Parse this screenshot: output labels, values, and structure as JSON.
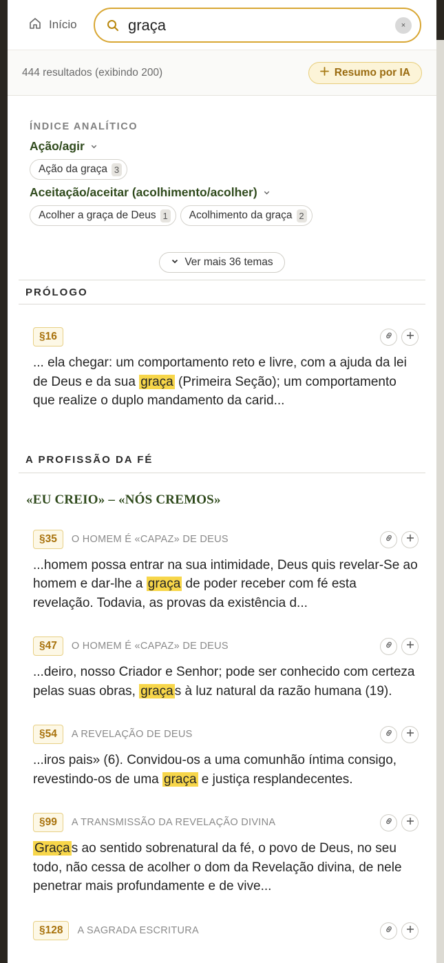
{
  "header": {
    "home_label": "Início",
    "search_value": "graça",
    "clear_symbol": "×"
  },
  "results": {
    "count_text": "444 resultados (exibindo 200)",
    "summary_label": "Resumo por IA",
    "summary_icon": "sparkle-plus"
  },
  "index": {
    "heading": "ÍNDICE ANALÍTICO",
    "topics": [
      {
        "label": "Ação/agir",
        "chips": [
          {
            "label": "Ação da graça",
            "count": "3"
          }
        ]
      },
      {
        "label": "Aceitação/aceitar (acolhimento/acolher)",
        "chips": [
          {
            "label": "Acolher a graça de Deus",
            "count": "1"
          },
          {
            "label": "Acolhimento da graça",
            "count": "2"
          }
        ]
      }
    ],
    "more_label": "Ver mais 36 temas"
  },
  "sections": [
    {
      "title": "PRÓLOGO"
    },
    {
      "title": "A PROFISSÃO DA FÉ",
      "subsection": "«EU CREIO» – «NÓS CREMOS»"
    }
  ],
  "entries": [
    {
      "para": "§16",
      "title": "",
      "before": "... ela chegar: um comportamento reto e livre, com a ajuda da lei de Deus e da sua ",
      "hl": "graça",
      "after": " (Primeira Seção); um comportamento que realize o duplo mandamento da carid..."
    },
    {
      "para": "§35",
      "title": "O HOMEM É «CAPAZ» DE DEUS",
      "before": "...homem possa entrar na sua intimidade, Deus quis revelar-Se ao homem e dar-lhe a ",
      "hl": "graça",
      "after": " de poder receber com fé esta revelação. Todavia, as provas da existência d..."
    },
    {
      "para": "§47",
      "title": "O HOMEM É «CAPAZ» DE DEUS",
      "before": "...deiro, nosso Criador e Senhor; pode ser conhecido com certeza pelas suas obras, ",
      "hl": "graça",
      "after": "s à luz natural da razão humana (19)."
    },
    {
      "para": "§54",
      "title": "A REVELAÇÃO DE DEUS",
      "before": "...iros pais» (6). Convidou-os a uma comunhão íntima consigo, revestindo-os de uma ",
      "hl": "graça",
      "after": " e justiça resplandecentes."
    },
    {
      "para": "§99",
      "title": "A TRANSMISSÃO DA REVELAÇÃO DIVINA",
      "before": "",
      "hl": "Graça",
      "after": "s ao sentido sobrenatural da fé, o povo de Deus, no seu todo, não cessa de acolher o dom da Revelação divina, de nele penetrar mais profundamente e de vive..."
    },
    {
      "para": "§128",
      "title": "A SAGRADA ESCRITURA",
      "before": "",
      "hl": "",
      "after": ""
    }
  ]
}
